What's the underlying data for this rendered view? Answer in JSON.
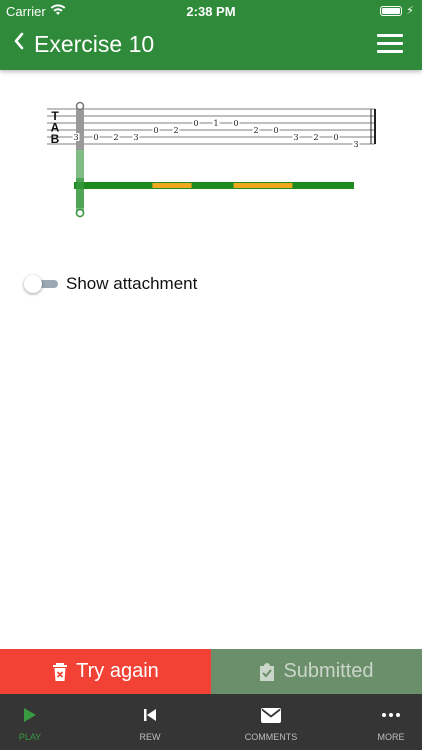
{
  "status_bar": {
    "carrier": "Carrier",
    "time": "2:38 PM",
    "battery_level": 1.0
  },
  "header": {
    "title": "Exercise 10",
    "back_icon": "chevron-left-icon",
    "menu_icon": "hamburger-menu-icon",
    "color": "#2f8a3a"
  },
  "tab": {
    "clef": [
      "T",
      "A",
      "B"
    ],
    "notes": [
      {
        "string": 5,
        "fret": "3"
      },
      {
        "string": 5,
        "fret": "0"
      },
      {
        "string": 5,
        "fret": "2"
      },
      {
        "string": 5,
        "fret": "3"
      },
      {
        "string": 4,
        "fret": "0"
      },
      {
        "string": 4,
        "fret": "2"
      },
      {
        "string": 3,
        "fret": "0"
      },
      {
        "string": 3,
        "fret": "1"
      },
      {
        "string": 3,
        "fret": "0"
      },
      {
        "string": 4,
        "fret": "2"
      },
      {
        "string": 4,
        "fret": "0"
      },
      {
        "string": 5,
        "fret": "3"
      },
      {
        "string": 5,
        "fret": "2"
      },
      {
        "string": 5,
        "fret": "0"
      },
      {
        "string": 6,
        "fret": "3"
      }
    ],
    "playhead_color": "#3a9a42",
    "timeline": {
      "color": "#1f8a1f",
      "highlight_color": "#f0a820",
      "highlight_segments": [
        [
          0.28,
          0.42
        ],
        [
          0.57,
          0.78
        ]
      ]
    }
  },
  "toggle": {
    "label": "Show attachment",
    "on": false
  },
  "actions": {
    "try_again": "Try again",
    "submitted": "Submitted",
    "try_color": "#f24236",
    "submitted_color": "#6b8f6b"
  },
  "tabbar": {
    "items": [
      {
        "label": "PLAY",
        "icon": "play-icon",
        "active": true
      },
      {
        "label": "REW",
        "icon": "rewind-icon",
        "active": false
      },
      {
        "label": "COMMENTS",
        "icon": "envelope-icon",
        "active": false
      },
      {
        "label": "MORE",
        "icon": "more-dots-icon",
        "active": false
      }
    ]
  }
}
